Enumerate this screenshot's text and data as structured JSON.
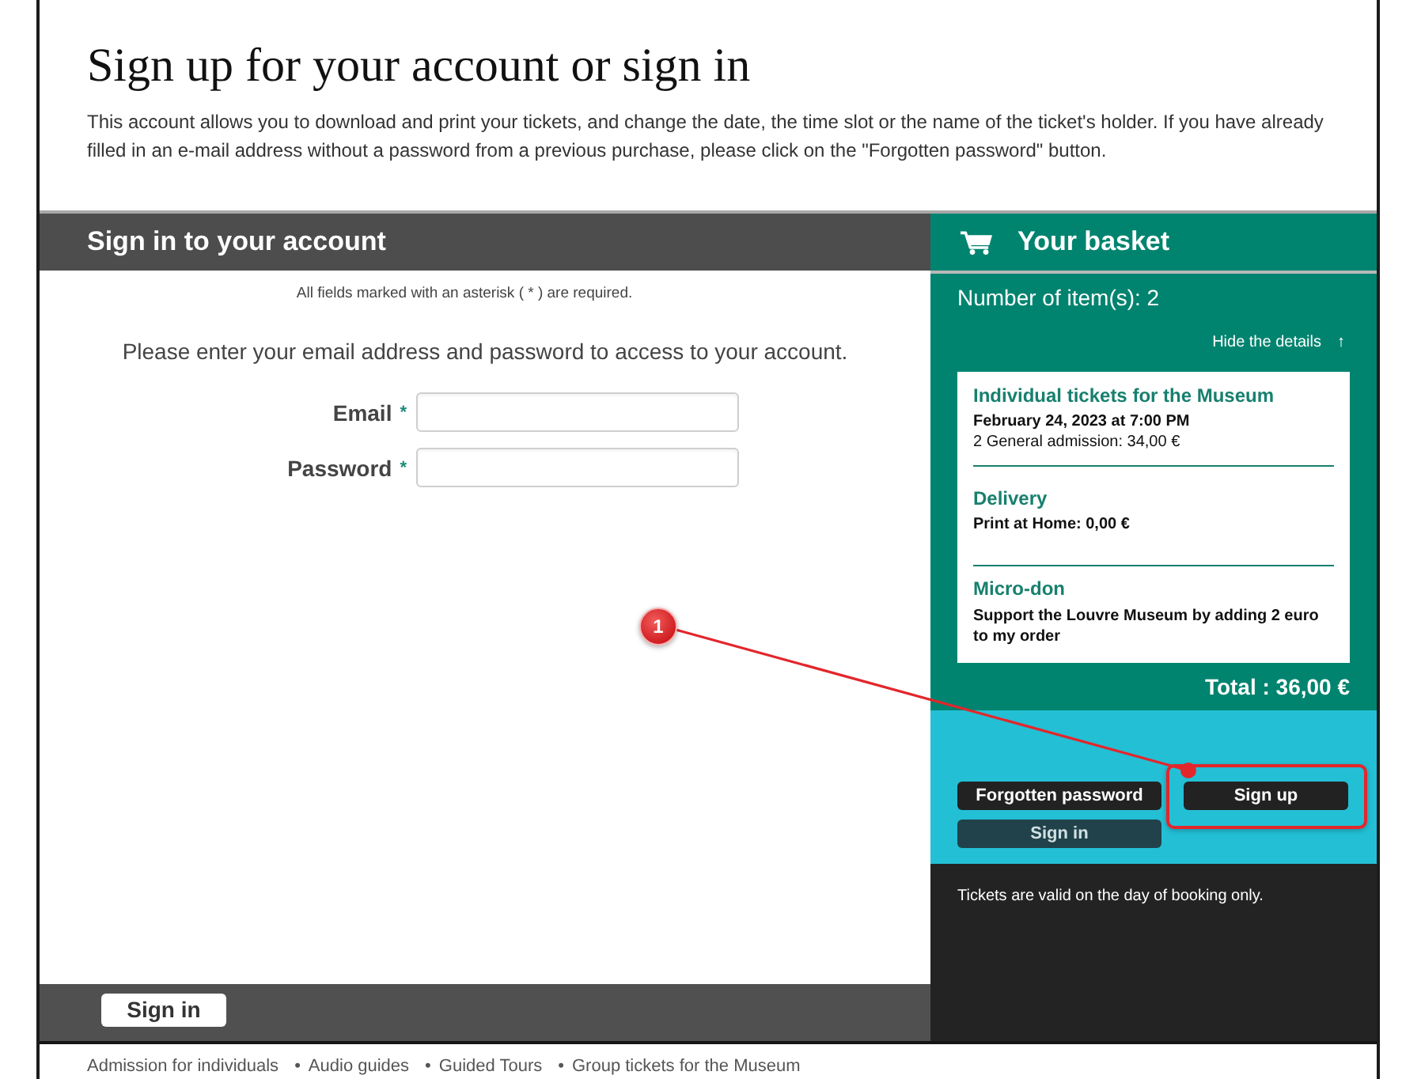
{
  "page": {
    "title": "Sign up for your account or sign in",
    "intro": "This account allows you to download and print your tickets, and change the date, the time slot or the name of the ticket's holder. If you have already filled in an e-mail address without a password from a previous purchase, please click on the \"Forgotten password\" button."
  },
  "signin_panel": {
    "title": "Sign in to your account",
    "required_note": "All fields marked with an asterisk ( * ) are required.",
    "instructions": "Please enter your email address and password to access to your account.",
    "required_mark": "*",
    "fields": [
      {
        "label": "Email",
        "required": true
      },
      {
        "label": "Password",
        "required": true
      }
    ],
    "submit": "Sign in"
  },
  "basket": {
    "title": "Your basket",
    "item_count": "Number of item(s): 2",
    "toggle": "Hide the details",
    "toggle_icon": "↑",
    "items": [
      {
        "title": "Individual tickets for the Museum",
        "details": [
          {
            "text": "February 24, 2023 at 7:00 PM",
            "bold": true
          },
          {
            "text": "2 General admission: 34,00 €",
            "bold": false
          }
        ]
      },
      {
        "title": "Delivery",
        "details": [
          {
            "text": "Print at Home: 0,00 €",
            "bold": true
          }
        ]
      },
      {
        "title": "Micro-don",
        "details": [
          {
            "text": "Support the Louvre Museum by adding 2 euro to my order",
            "bold": true
          }
        ]
      }
    ],
    "total": "Total : 36,00 €",
    "buttons": [
      {
        "label": "Forgotten password",
        "kind": "primary",
        "highlighted": false
      },
      {
        "label": "Sign up",
        "kind": "primary",
        "highlighted": true
      },
      {
        "label": "Sign in",
        "kind": "secondary",
        "highlighted": false
      }
    ],
    "note": "Tickets are valid on the day of booking only."
  },
  "footer": {
    "separator": "•",
    "links": [
      "Admission for individuals",
      "Audio guides",
      "Guided Tours",
      "Group tickets for the Museum"
    ]
  },
  "annotation": {
    "number": "1"
  }
}
